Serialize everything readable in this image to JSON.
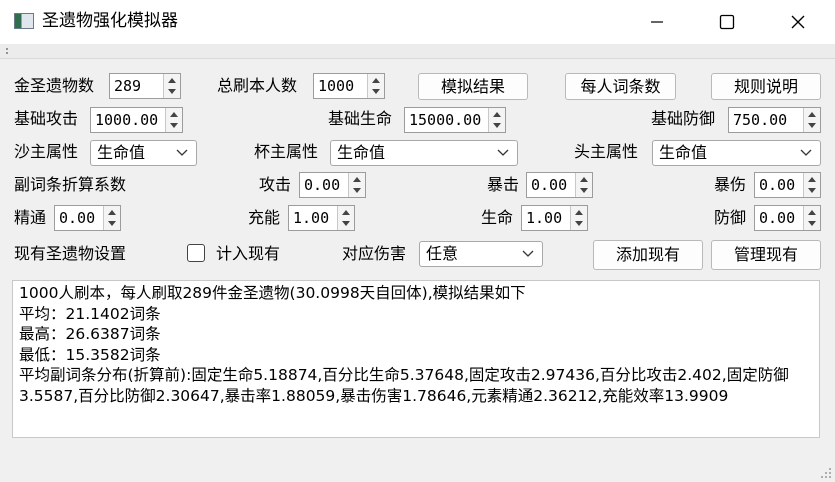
{
  "window": {
    "title": "圣遗物强化模拟器",
    "icons": [
      "app-icon",
      "minimize-icon",
      "maximize-icon",
      "close-icon"
    ]
  },
  "row1": {
    "artifact_count_label": "金圣遗物数",
    "artifact_count_value": "289",
    "players_label": "总刷本人数",
    "players_value": "1000",
    "simulate_button": "模拟结果",
    "per_player_button": "每人词条数",
    "rules_button": "规则说明"
  },
  "row2": {
    "base_atk_label": "基础攻击",
    "base_atk_value": "1000.00",
    "base_hp_label": "基础生命",
    "base_hp_value": "15000.00",
    "base_def_label": "基础防御",
    "base_def_value": "750.00"
  },
  "row3": {
    "sands_label": "沙主属性",
    "sands_value": "生命值",
    "goblet_label": "杯主属性",
    "goblet_value": "生命值",
    "circlet_label": "头主属性",
    "circlet_value": "生命值"
  },
  "row4": {
    "coef_label": "副词条折算系数",
    "atk_label": "攻击",
    "atk_value": "0.00",
    "crit_rate_label": "暴击",
    "crit_rate_value": "0.00",
    "crit_dmg_label": "暴伤",
    "crit_dmg_value": "0.00"
  },
  "row5": {
    "em_label": "精通",
    "em_value": "0.00",
    "er_label": "充能",
    "er_value": "1.00",
    "hp_label": "生命",
    "hp_value": "1.00",
    "def_label": "防御",
    "def_value": "0.00"
  },
  "row6": {
    "existing_label": "现有圣遗物设置",
    "include_label": "计入现有",
    "include_checked": false,
    "damage_label": "对应伤害",
    "damage_value": "任意",
    "add_button": "添加现有",
    "manage_button": "管理现有"
  },
  "output": {
    "lines": [
      "1000人刷本，每人刷取289件金圣遗物(30.0998天自回体),模拟结果如下",
      "平均：21.1402词条",
      "最高：26.6387词条",
      "最低：15.3582词条",
      "平均副词条分布(折算前):固定生命5.18874,百分比生命5.37648,固定攻击2.97436,百分比攻击2.402,固定防御3.5587,百分比防御2.30647,暴击率1.88059,暴击伤害1.78646,元素精通2.36212,充能效率13.9909"
    ]
  }
}
